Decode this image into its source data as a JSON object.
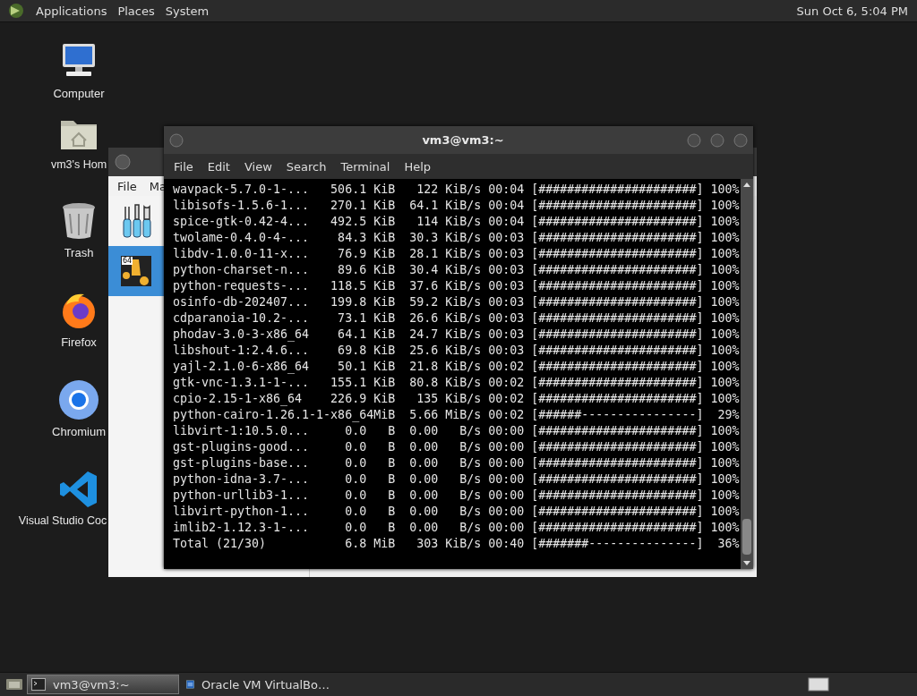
{
  "top_panel": {
    "menus": [
      "Applications",
      "Places",
      "System"
    ],
    "clock": "Sun Oct 6, 5:04 PM"
  },
  "desktop_icons": [
    {
      "kind": "computer",
      "label": "Computer"
    },
    {
      "kind": "home",
      "label": "vm3's Hom"
    },
    {
      "kind": "trash",
      "label": "Trash"
    },
    {
      "kind": "firefox",
      "label": "Firefox"
    },
    {
      "kind": "chromium",
      "label": "Chromium"
    },
    {
      "kind": "vscode",
      "label": "Visual Studio Coc"
    }
  ],
  "background_window": {
    "menus": [
      "File",
      "Ma"
    ],
    "rows": [
      {
        "kind": "tools",
        "selected": false
      },
      {
        "kind": "vm",
        "selected": true,
        "badge": "64"
      }
    ]
  },
  "terminal": {
    "title": "vm3@vm3:~",
    "menus": [
      "File",
      "Edit",
      "View",
      "Search",
      "Terminal",
      "Help"
    ],
    "lines": [
      "wavpack-5.7.0-1-...   506.1 KiB   122 KiB/s 00:04 [######################] 100%",
      "libisofs-1.5.6-1...   270.1 KiB  64.1 KiB/s 00:04 [######################] 100%",
      "spice-gtk-0.42-4...   492.5 KiB   114 KiB/s 00:04 [######################] 100%",
      "twolame-0.4.0-4-...    84.3 KiB  30.3 KiB/s 00:03 [######################] 100%",
      "libdv-1.0.0-11-x...    76.9 KiB  28.1 KiB/s 00:03 [######################] 100%",
      "python-charset-n...    89.6 KiB  30.4 KiB/s 00:03 [######################] 100%",
      "python-requests-...   118.5 KiB  37.6 KiB/s 00:03 [######################] 100%",
      "osinfo-db-202407...   199.8 KiB  59.2 KiB/s 00:03 [######################] 100%",
      "cdparanoia-10.2-...    73.1 KiB  26.6 KiB/s 00:03 [######################] 100%",
      "phodav-3.0-3-x86_64    64.1 KiB  24.7 KiB/s 00:03 [######################] 100%",
      "libshout-1:2.4.6...    69.8 KiB  25.6 KiB/s 00:03 [######################] 100%",
      "yajl-2.1.0-6-x86_64    50.1 KiB  21.8 KiB/s 00:02 [######################] 100%",
      "gtk-vnc-1.3.1-1-...   155.1 KiB  80.8 KiB/s 00:02 [######################] 100%",
      "cpio-2.15-1-x86_64    226.9 KiB   135 KiB/s 00:02 [######################] 100%",
      "python-cairo-1.26.1-1-x86_64MiB  5.66 MiB/s 00:02 [######----------------]  29%",
      "libvirt-1:10.5.0...     0.0   B  0.00   B/s 00:00 [######################] 100%",
      "gst-plugins-good...     0.0   B  0.00   B/s 00:00 [######################] 100%",
      "gst-plugins-base...     0.0   B  0.00   B/s 00:00 [######################] 100%",
      "python-idna-3.7-...     0.0   B  0.00   B/s 00:00 [######################] 100%",
      "python-urllib3-1...     0.0   B  0.00   B/s 00:00 [######################] 100%",
      "libvirt-python-1...     0.0   B  0.00   B/s 00:00 [######################] 100%",
      "imlib2-1.12.3-1-...     0.0   B  0.00   B/s 00:00 [######################] 100%",
      "Total (21/30)           6.8 MiB   303 KiB/s 00:40 [#######---------------]  36%"
    ]
  },
  "taskbar": {
    "tasks": [
      {
        "kind": "terminal",
        "label": "vm3@vm3:~",
        "selected": true
      },
      {
        "kind": "virtualbox",
        "label": "Oracle VM VirtualBo…",
        "selected": false
      }
    ]
  }
}
